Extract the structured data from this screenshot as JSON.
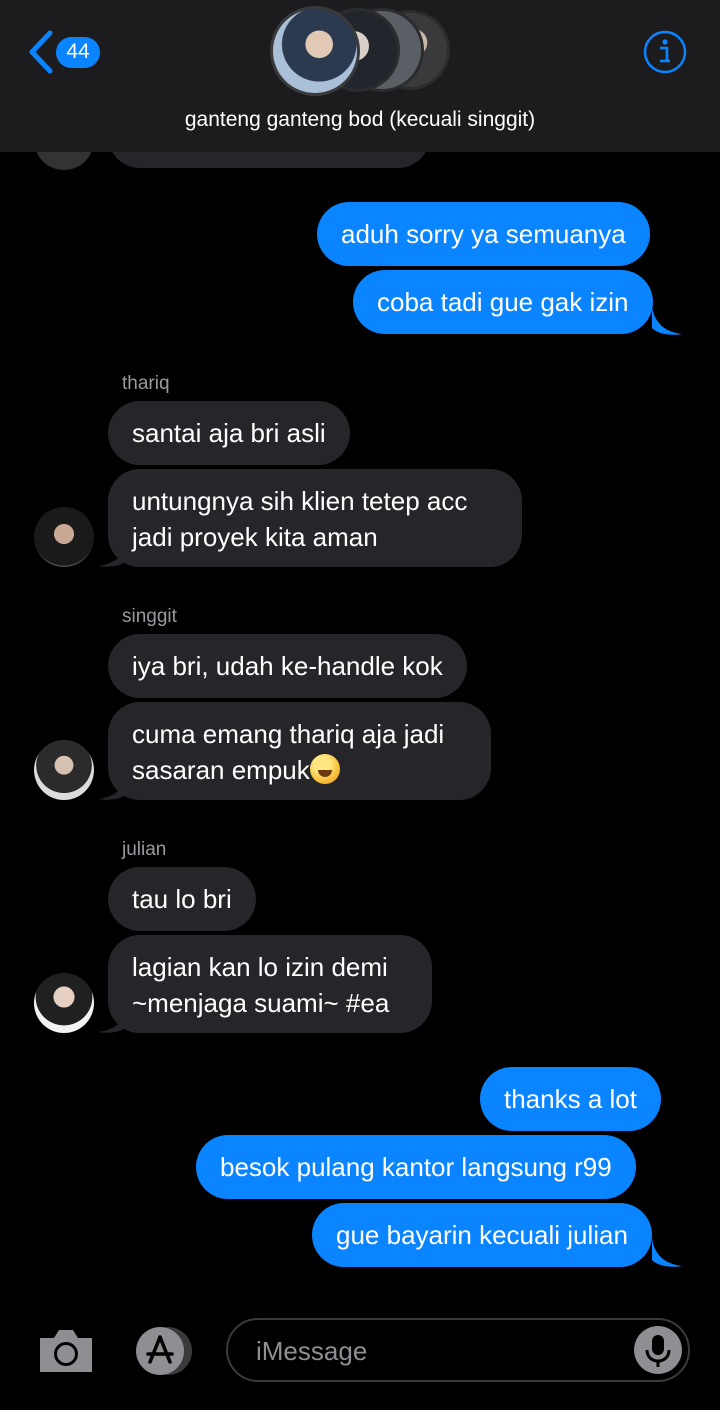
{
  "header": {
    "unread_count": "44",
    "group_title": "ganteng ganteng bod (kecuali singgit)"
  },
  "messages": {
    "out1": "aduh sorry ya semuanya",
    "out2": "coba tadi gue gak izin",
    "tharik_name": "thariq",
    "tharik1": "santai aja bri asli",
    "tharik2_line1": "untungnya sih klien tetep acc",
    "tharik2_line2": "jadi proyek kita aman",
    "singgit_name": "singgit",
    "singgit1": "iya bri, udah ke-handle kok",
    "singgit2_line1": "cuma emang thariq aja jadi",
    "singgit2_line2": "sasaran empuk",
    "julian_name": "julian",
    "julian1": "tau lo bri",
    "julian2_line1": "lagian kan lo izin demi",
    "julian2_line2": "~menjaga suami~ #ea",
    "out3": "thanks a lot",
    "out4": "besok pulang kantor langsung r99",
    "out5": "gue bayarin kecuali julian"
  },
  "composer": {
    "placeholder": "iMessage"
  },
  "icons": {
    "back": "chevron-left-icon",
    "info": "info-icon",
    "camera": "camera-icon",
    "appstore": "app-store-icon",
    "mic": "microphone-icon",
    "emoji": "grinning-face-with-sweat-emoji"
  },
  "colors": {
    "accent": "#0a84ff",
    "incoming_bubble": "#26252a",
    "header_bg": "#1c1c1e"
  }
}
